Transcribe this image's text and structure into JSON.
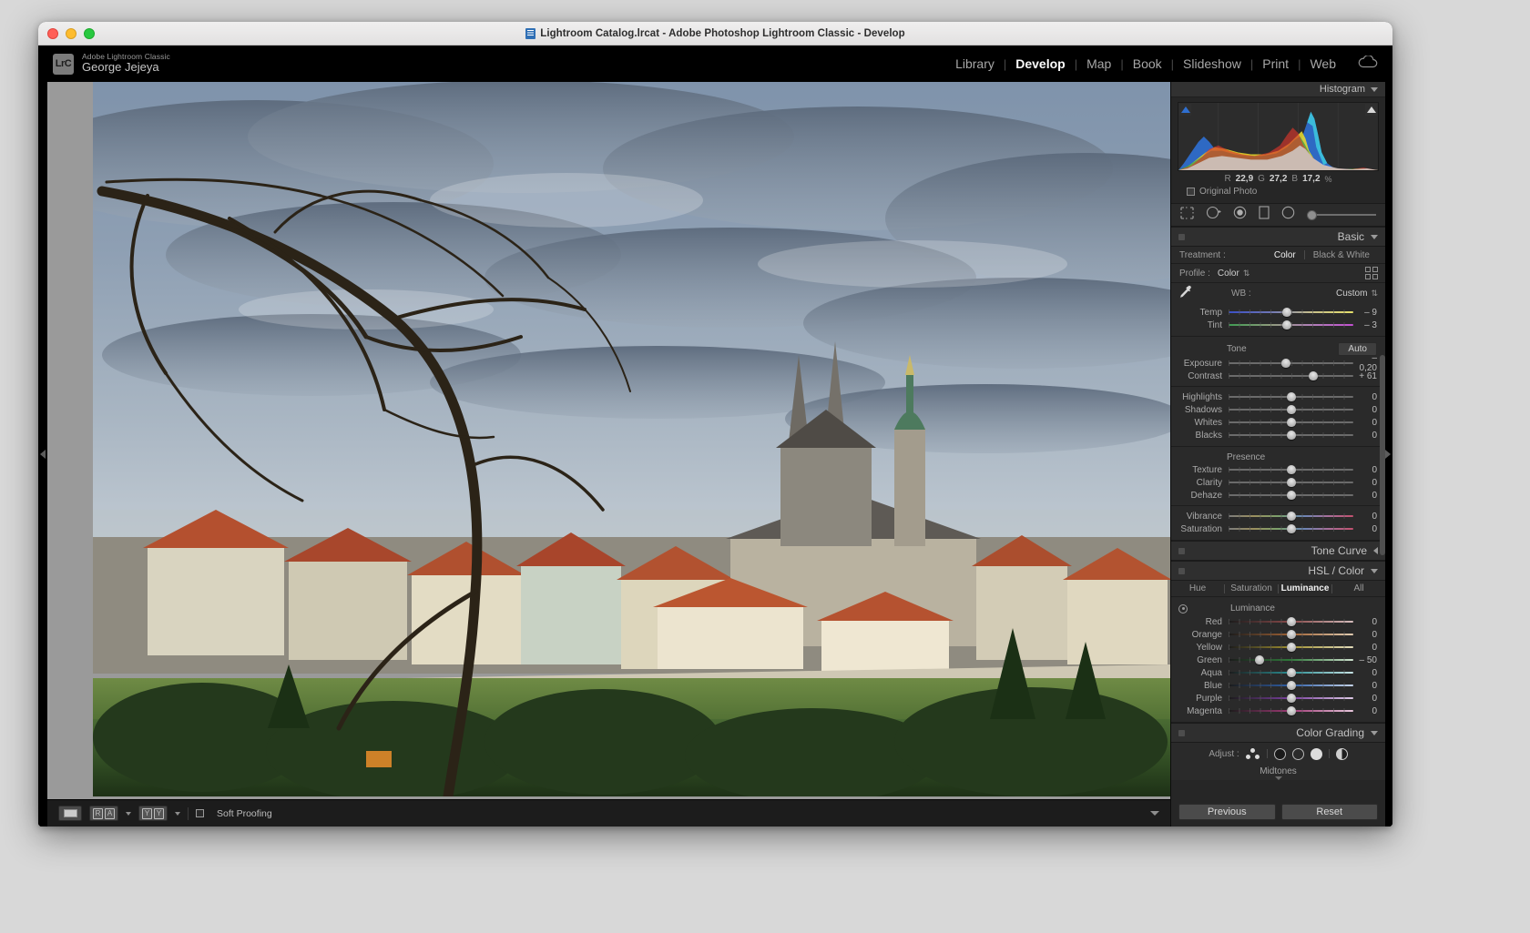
{
  "window": {
    "title": "Lightroom Catalog.lrcat - Adobe Photoshop Lightroom Classic - Develop"
  },
  "identity": {
    "logo_text": "LrC",
    "app_name": "Adobe Lightroom Classic",
    "user_name": "George Jejeya"
  },
  "modules": {
    "items": [
      {
        "label": "Library",
        "active": false
      },
      {
        "label": "Develop",
        "active": true
      },
      {
        "label": "Map",
        "active": false
      },
      {
        "label": "Book",
        "active": false
      },
      {
        "label": "Slideshow",
        "active": false
      },
      {
        "label": "Print",
        "active": false
      },
      {
        "label": "Web",
        "active": false
      }
    ],
    "separator": "|",
    "cloud_icon": "cloud-icon"
  },
  "histogram": {
    "panel_title": "Histogram",
    "rgb": {
      "r_label": "R",
      "r_value": "22,9",
      "g_label": "G",
      "g_value": "27,2",
      "b_label": "B",
      "b_value": "17,2",
      "unit": "%"
    },
    "original_photo_label": "Original Photo",
    "clip_left_icon": "shadow-clipping-icon",
    "clip_right_icon": "highlight-clipping-icon"
  },
  "tools": [
    {
      "name": "crop-overlay-tool"
    },
    {
      "name": "spot-removal-tool"
    },
    {
      "name": "red-eye-tool"
    },
    {
      "name": "masking-tool"
    },
    {
      "name": "radial-gradient-tool"
    }
  ],
  "basic": {
    "section_title": "Basic",
    "treatment_label": "Treatment :",
    "treatment_options": [
      {
        "label": "Color",
        "selected": true
      },
      {
        "label": "Black & White",
        "selected": false
      }
    ],
    "profile_label": "Profile :",
    "profile_value": "Color",
    "wb_label": "WB :",
    "wb_value": "Custom",
    "white_balance": [
      {
        "label": "Temp",
        "value": "– 9",
        "pos": 47
      },
      {
        "label": "Tint",
        "value": "– 3",
        "pos": 47
      }
    ],
    "tone_label": "Tone",
    "auto_label": "Auto",
    "tone": [
      {
        "label": "Exposure",
        "value": "– 0,20",
        "pos": 46
      },
      {
        "label": "Contrast",
        "value": "+ 61",
        "pos": 68
      },
      {
        "label": "Highlights",
        "value": "0",
        "pos": 50
      },
      {
        "label": "Shadows",
        "value": "0",
        "pos": 50
      },
      {
        "label": "Whites",
        "value": "0",
        "pos": 50
      },
      {
        "label": "Blacks",
        "value": "0",
        "pos": 50
      }
    ],
    "presence_label": "Presence",
    "presence": [
      {
        "label": "Texture",
        "value": "0",
        "pos": 50
      },
      {
        "label": "Clarity",
        "value": "0",
        "pos": 50
      },
      {
        "label": "Dehaze",
        "value": "0",
        "pos": 50
      }
    ],
    "color_mix": [
      {
        "label": "Vibrance",
        "value": "0",
        "pos": 50
      },
      {
        "label": "Saturation",
        "value": "0",
        "pos": 50
      }
    ]
  },
  "tone_curve": {
    "section_title": "Tone Curve"
  },
  "hsl": {
    "section_title": "HSL / Color",
    "tabs": [
      {
        "label": "Hue",
        "selected": false
      },
      {
        "label": "Saturation",
        "selected": false
      },
      {
        "label": "Luminance",
        "selected": true
      },
      {
        "label": "All",
        "selected": false
      }
    ],
    "group_label": "Luminance",
    "sliders": [
      {
        "label": "Red",
        "value": "0",
        "pos": 50,
        "grad": "g-red"
      },
      {
        "label": "Orange",
        "value": "0",
        "pos": 50,
        "grad": "g-orange"
      },
      {
        "label": "Yellow",
        "value": "0",
        "pos": 50,
        "grad": "g-yellow"
      },
      {
        "label": "Green",
        "value": "– 50",
        "pos": 25,
        "grad": "g-green"
      },
      {
        "label": "Aqua",
        "value": "0",
        "pos": 50,
        "grad": "g-aqua"
      },
      {
        "label": "Blue",
        "value": "0",
        "pos": 50,
        "grad": "g-blue"
      },
      {
        "label": "Purple",
        "value": "0",
        "pos": 50,
        "grad": "g-purple"
      },
      {
        "label": "Magenta",
        "value": "0",
        "pos": 50,
        "grad": "g-magenta"
      }
    ]
  },
  "color_grading": {
    "section_title": "Color Grading",
    "adjust_label": "Adjust :",
    "active_wheel": "Midtones",
    "wheel_label": "Midtones"
  },
  "panel_buttons": {
    "previous": "Previous",
    "reset": "Reset"
  },
  "toolbar": {
    "view_loupe_icon": "loupe-view-icon",
    "before_after_icon": "before-after-icon",
    "compare_icon": "ya-yb-icon",
    "soft_proofing_label": "Soft Proofing"
  },
  "colors": {
    "panel_bg": "#262626",
    "panel_section": "#2a2a2a",
    "accent_blue": "#2f6fd0",
    "text_primary": "#cfcfcf",
    "text_muted": "#9a9a9a",
    "canvas_bg": "#9a9a9a"
  }
}
